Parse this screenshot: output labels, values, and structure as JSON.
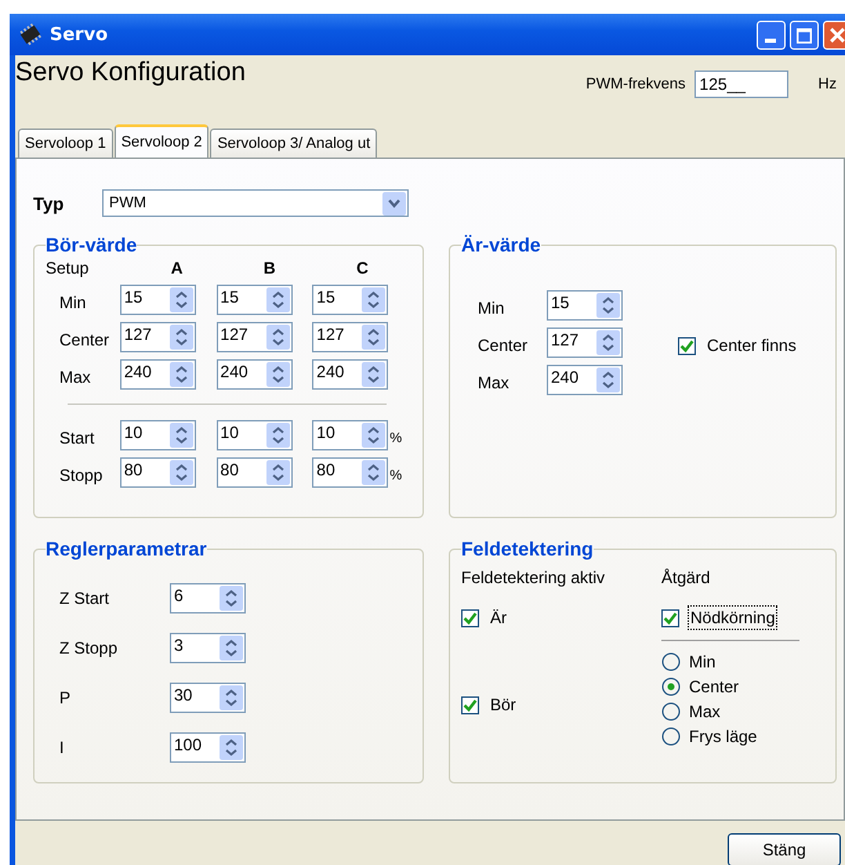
{
  "window": {
    "title": "Servo"
  },
  "header": {
    "title": "Servo Konfiguration",
    "pwm_label": "PWM-frekvens",
    "pwm_value": "125__",
    "pwm_unit": "Hz"
  },
  "tabs": [
    {
      "label": "Servoloop 1",
      "selected": false
    },
    {
      "label": "Servoloop 2",
      "selected": true
    },
    {
      "label": "Servoloop 3/ Analog ut",
      "selected": false
    }
  ],
  "typ": {
    "label": "Typ",
    "value": "PWM"
  },
  "bor_varde": {
    "title": "Bör-värde",
    "setup_label": "Setup",
    "columns": [
      "A",
      "B",
      "C"
    ],
    "limits": [
      {
        "label": "Min",
        "values": [
          "15",
          "15",
          "15"
        ]
      },
      {
        "label": "Center",
        "values": [
          "127",
          "127",
          "127"
        ]
      },
      {
        "label": "Max",
        "values": [
          "240",
          "240",
          "240"
        ]
      }
    ],
    "ramp": [
      {
        "label": "Start",
        "values": [
          "10",
          "10",
          "10"
        ],
        "unit": "%"
      },
      {
        "label": "Stopp",
        "values": [
          "80",
          "80",
          "80"
        ],
        "unit": "%"
      }
    ]
  },
  "ar_varde": {
    "title": "Är-värde",
    "rows": [
      {
        "label": "Min",
        "value": "15"
      },
      {
        "label": "Center",
        "value": "127"
      },
      {
        "label": "Max",
        "value": "240"
      }
    ],
    "center_check": {
      "label": "Center finns",
      "checked": true
    }
  },
  "reglerparametrar": {
    "title": "Reglerparametrar",
    "rows": [
      {
        "label": "Z Start",
        "value": "6"
      },
      {
        "label": "Z Stopp",
        "value": "3"
      },
      {
        "label": "P",
        "value": "30"
      },
      {
        "label": "I",
        "value": "100"
      }
    ]
  },
  "feldetektering": {
    "title": "Feldetektering",
    "active_label": "Feldetektering aktiv",
    "action_label": "Åtgärd",
    "active_checks": [
      {
        "label": "Är",
        "checked": true
      },
      {
        "label": "Bör",
        "checked": true
      }
    ],
    "action_check": {
      "label": "Nödkörning",
      "checked": true,
      "focused": true
    },
    "options": [
      {
        "label": "Min",
        "selected": false
      },
      {
        "label": "Center",
        "selected": true
      },
      {
        "label": "Max",
        "selected": false
      },
      {
        "label": "Frys läge",
        "selected": false
      }
    ]
  },
  "close_button": "Stäng"
}
